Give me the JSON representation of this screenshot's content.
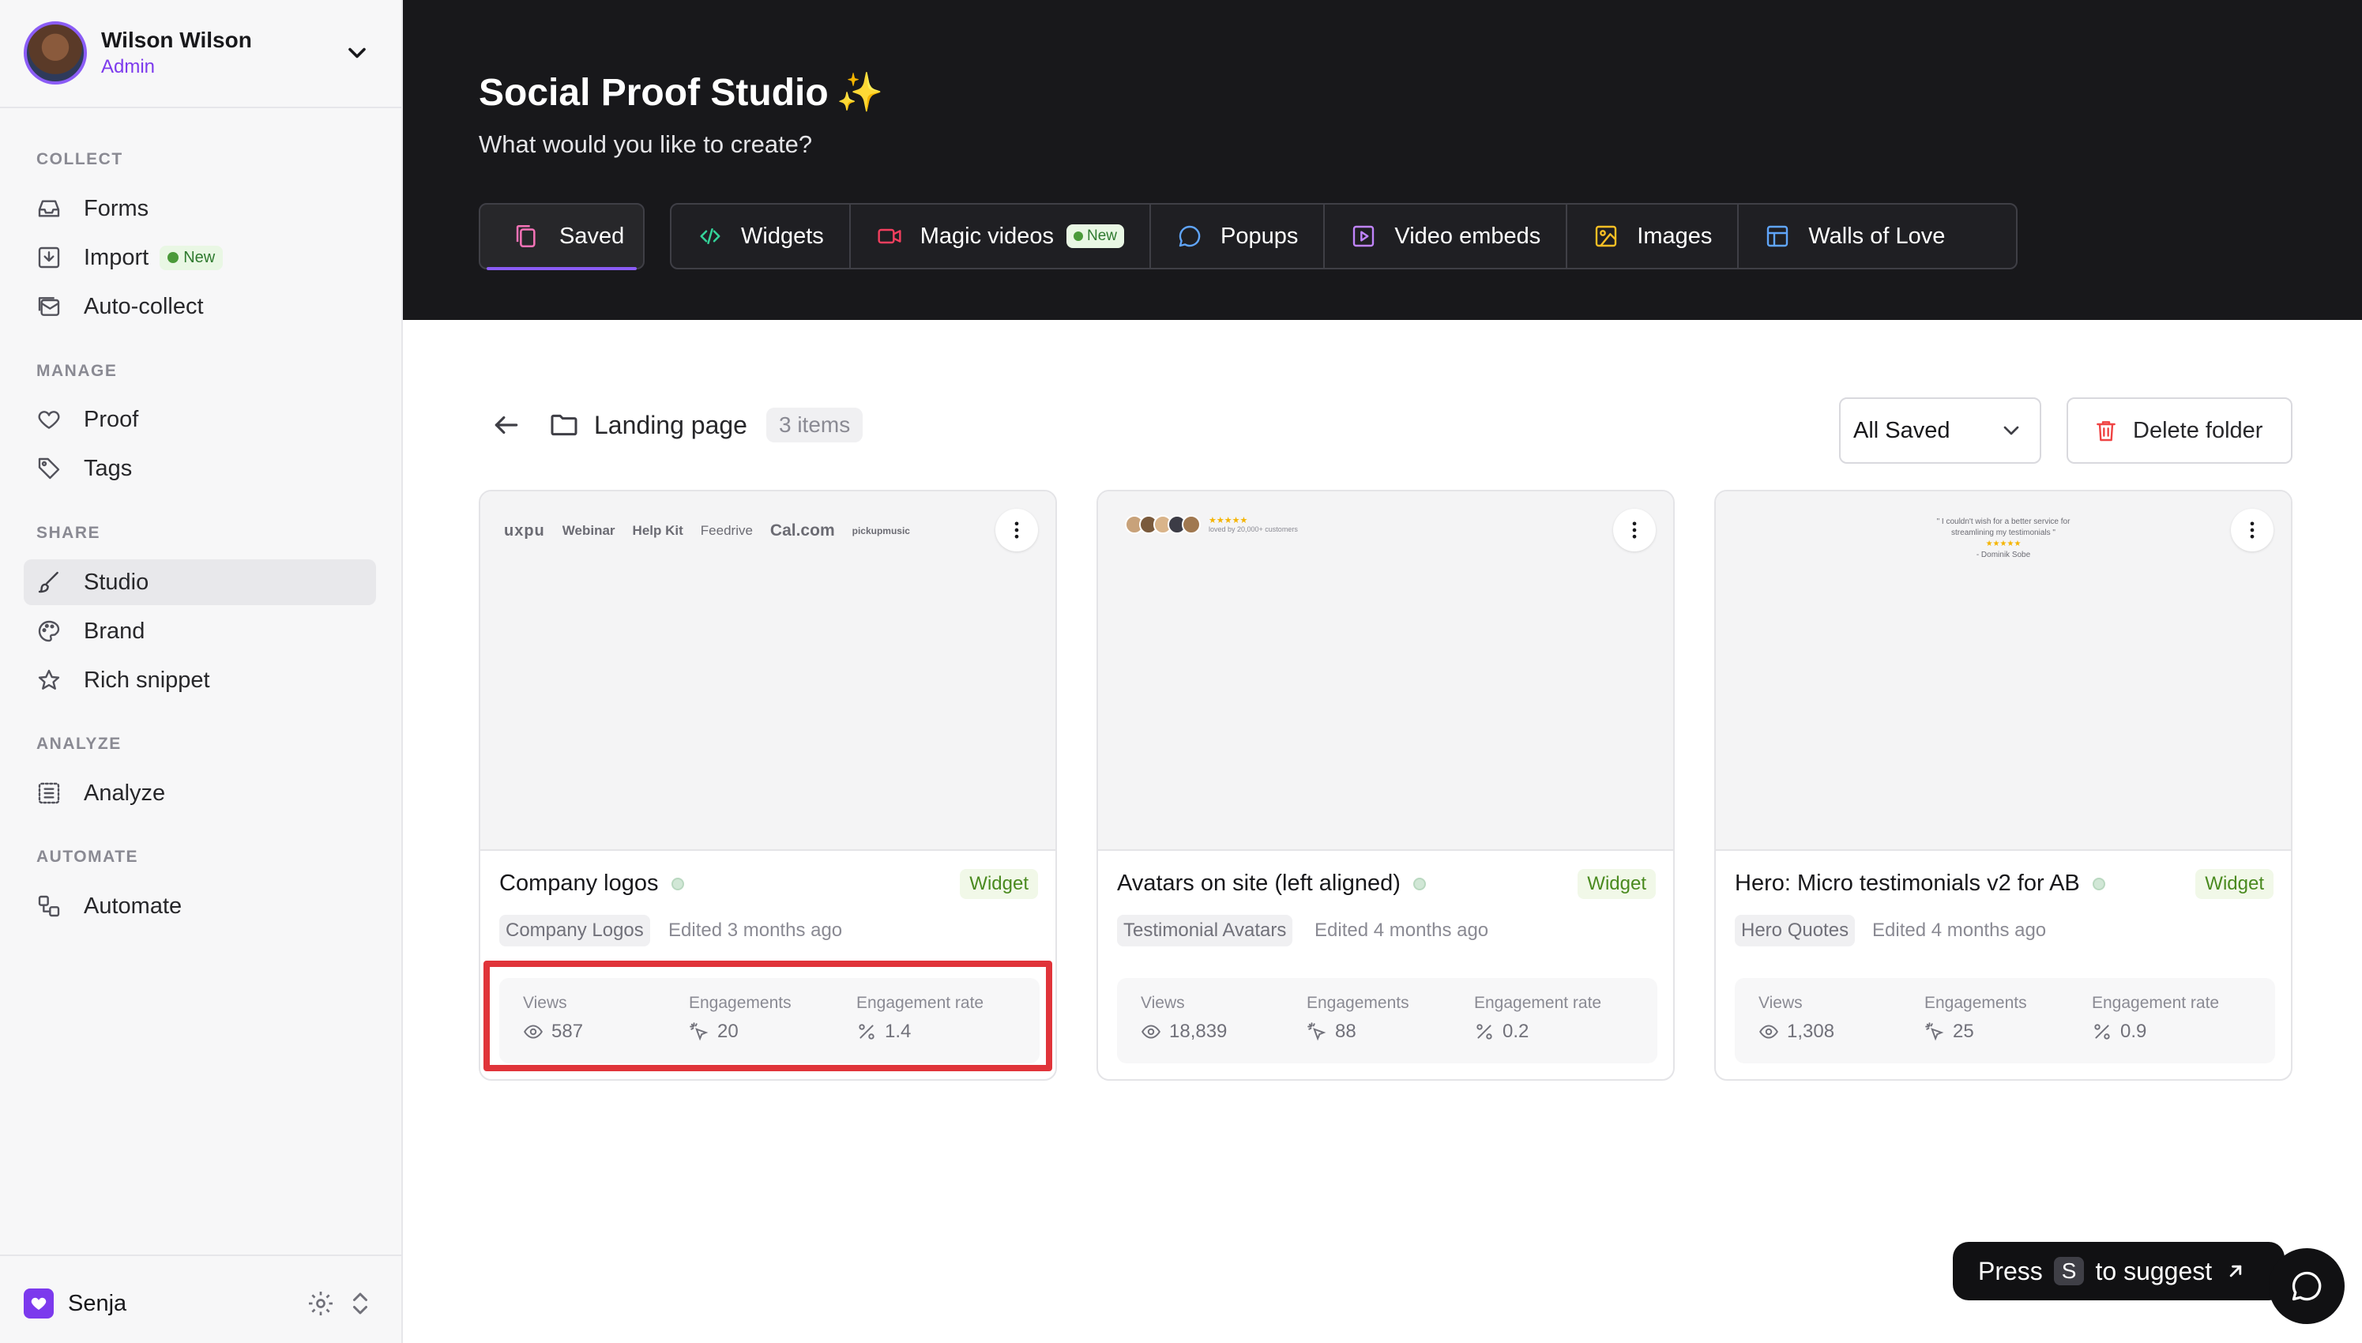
{
  "user": {
    "name": "Wilson Wilson",
    "role": "Admin"
  },
  "sidebar": {
    "sections": [
      {
        "title": "COLLECT"
      },
      {
        "title": "MANAGE"
      },
      {
        "title": "SHARE"
      },
      {
        "title": "ANALYZE"
      },
      {
        "title": "AUTOMATE"
      }
    ],
    "items": {
      "forms": "Forms",
      "import": "Import",
      "import_badge": "New",
      "auto_collect": "Auto-collect",
      "proof": "Proof",
      "tags": "Tags",
      "studio": "Studio",
      "brand": "Brand",
      "rich_snippet": "Rich snippet",
      "analyze": "Analyze",
      "automate": "Automate"
    },
    "workspace": "Senja"
  },
  "header": {
    "title": "Social Proof Studio",
    "sparkle": "✨",
    "subtitle": "What would you like to create?",
    "tabs": {
      "saved": "Saved",
      "widgets": "Widgets",
      "magic_videos": "Magic videos",
      "magic_badge": "New",
      "popups": "Popups",
      "video_embeds": "Video embeds",
      "images": "Images",
      "walls": "Walls of Love"
    }
  },
  "folder": {
    "name": "Landing page",
    "count": "3 items"
  },
  "filter": {
    "selected": "All Saved"
  },
  "actions": {
    "delete_folder": "Delete folder"
  },
  "cards": [
    {
      "title": "Company logos",
      "type": "Widget",
      "tag": "Company Logos",
      "edited": "Edited 3 months ago",
      "views_label": "Views",
      "views": "587",
      "engagements_label": "Engagements",
      "engagements": "20",
      "rate_label": "Engagement rate",
      "rate": "1.4",
      "preview": {
        "logos": [
          "uxpu",
          "Webinar",
          "Help Kit",
          "Feedrive",
          "Cal.com",
          "pickupmusic"
        ]
      }
    },
    {
      "title": "Avatars on site (left aligned)",
      "type": "Widget",
      "tag": "Testimonial Avatars",
      "edited": "Edited 4 months ago",
      "views_label": "Views",
      "views": "18,839",
      "engagements_label": "Engagements",
      "engagements": "88",
      "rate_label": "Engagement rate",
      "rate": "0.2",
      "preview": {
        "stars": "★★★★★",
        "caption": "loved by 20,000+ customers"
      }
    },
    {
      "title": "Hero: Micro testimonials v2 for AB",
      "type": "Widget",
      "tag": "Hero Quotes",
      "edited": "Edited 4 months ago",
      "views_label": "Views",
      "views": "1,308",
      "engagements_label": "Engagements",
      "engagements": "25",
      "rate_label": "Engagement rate",
      "rate": "0.9",
      "preview": {
        "quote_line1": "\" I couldn't wish for a better service for",
        "quote_line2": "streamlining my testimonials \"",
        "stars": "★★★★★",
        "author": "- Dominik Sobe"
      }
    }
  ],
  "suggest": {
    "pre": "Press",
    "key": "S",
    "post": "to suggest"
  }
}
